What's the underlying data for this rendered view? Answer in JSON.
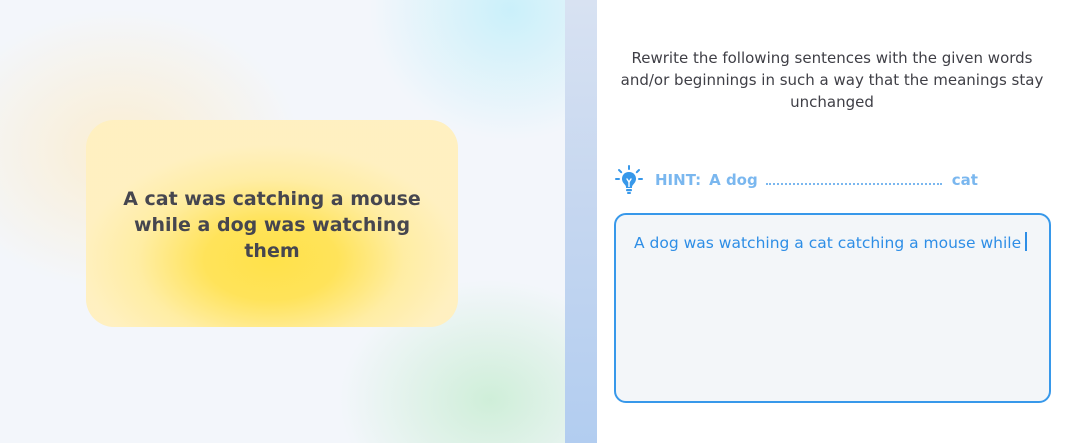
{
  "prompt": {
    "sentence": "A cat was catching a mouse while a dog was watching them"
  },
  "exercise": {
    "instructions": "Rewrite the following sentences with the given words and/or beginnings in such a way that the meanings stay unchanged",
    "hint": {
      "label": "HINT:",
      "start": "A dog",
      "end": "cat",
      "icon": "lightbulb-icon"
    },
    "answer": {
      "value": "A dog was watching a cat catching a mouse while"
    }
  },
  "colors": {
    "accent": "#3798ea",
    "hint": "#7ab7ef",
    "card_yellow": "#ffe24a",
    "text_dark": "#46464f"
  }
}
